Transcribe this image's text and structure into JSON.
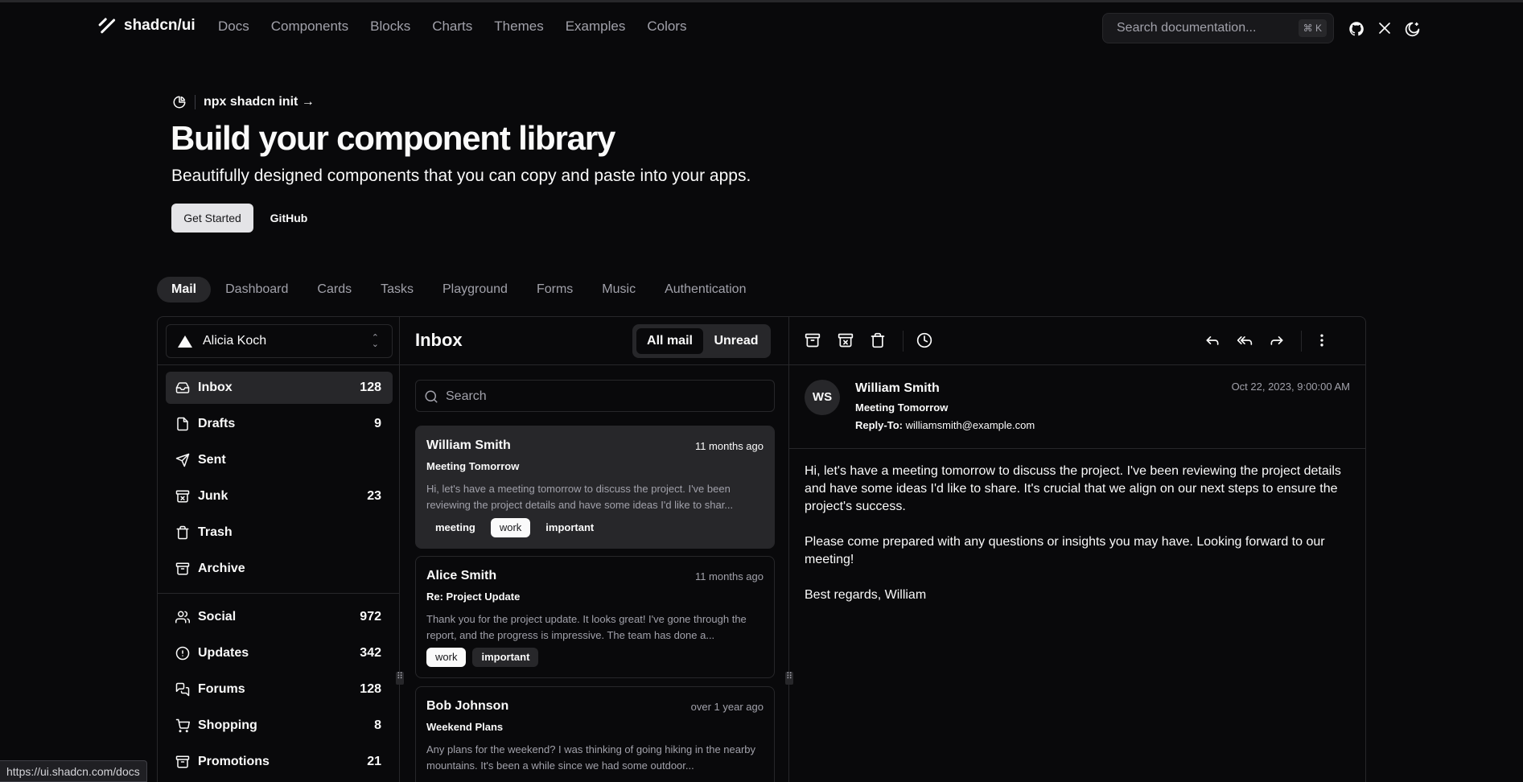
{
  "nav": {
    "logo": "shadcn/ui",
    "links": [
      "Docs",
      "Components",
      "Blocks",
      "Charts",
      "Themes",
      "Examples",
      "Colors"
    ],
    "search_placeholder": "Search documentation...",
    "search_kbd": "⌘ K",
    "icons": [
      "github-icon",
      "x-icon",
      "theme-toggle-icon"
    ]
  },
  "hero": {
    "announcement": "npx shadcn init →",
    "title": "Build your component library",
    "subtitle": "Beautifully designed components that you can copy and paste into your apps.",
    "primary_button": "Get Started",
    "secondary_button": "GitHub"
  },
  "example_tabs": {
    "items": [
      "Mail",
      "Dashboard",
      "Cards",
      "Tasks",
      "Playground",
      "Forms",
      "Music",
      "Authentication"
    ],
    "active": "Mail"
  },
  "mail": {
    "account": "Alicia Koch",
    "folders": [
      {
        "label": "Inbox",
        "count": "128",
        "icon": "inbox-icon",
        "active": true
      },
      {
        "label": "Drafts",
        "count": "9",
        "icon": "file-icon"
      },
      {
        "label": "Sent",
        "count": "",
        "icon": "send-icon"
      },
      {
        "label": "Junk",
        "count": "23",
        "icon": "archive-x-icon"
      },
      {
        "label": "Trash",
        "count": "",
        "icon": "trash-icon"
      },
      {
        "label": "Archive",
        "count": "",
        "icon": "archive-icon"
      }
    ],
    "categories": [
      {
        "label": "Social",
        "count": "972",
        "icon": "users-icon"
      },
      {
        "label": "Updates",
        "count": "342",
        "icon": "alert-circle-icon"
      },
      {
        "label": "Forums",
        "count": "128",
        "icon": "messages-icon"
      },
      {
        "label": "Shopping",
        "count": "8",
        "icon": "cart-icon"
      },
      {
        "label": "Promotions",
        "count": "21",
        "icon": "archive-icon"
      }
    ],
    "list": {
      "title": "Inbox",
      "toggle": [
        "All mail",
        "Unread"
      ],
      "toggle_active": "All mail",
      "search_placeholder": "Search",
      "messages": [
        {
          "from": "William Smith",
          "time": "11 months ago",
          "subject": "Meeting Tomorrow",
          "preview": "Hi, let's have a meeting tomorrow to discuss the project. I've been reviewing the project details and have some ideas I'd like to shar...",
          "tags": [
            "meeting",
            "work",
            "important"
          ],
          "selected": true
        },
        {
          "from": "Alice Smith",
          "time": "11 months ago",
          "subject": "Re: Project Update",
          "preview": "Thank you for the project update. It looks great! I've gone through the report, and the progress is impressive. The team has done a...",
          "tags": [
            "work",
            "important"
          ]
        },
        {
          "from": "Bob Johnson",
          "time": "over 1 year ago",
          "subject": "Weekend Plans",
          "preview": "Any plans for the weekend? I was thinking of going hiking in the nearby mountains. It's been a while since we had some outdoor...",
          "tags": []
        }
      ]
    },
    "detail": {
      "avatar_initials": "WS",
      "from": "William Smith",
      "subject": "Meeting Tomorrow",
      "reply_to_label": "Reply-To:",
      "reply_to": "williamsmith@example.com",
      "date": "Oct 22, 2023, 9:00:00 AM",
      "body": [
        "Hi, let's have a meeting tomorrow to discuss the project. I've been reviewing the project details and have some ideas I'd like to share. It's crucial that we align on our next steps to ensure the project's success.",
        "Please come prepared with any questions or insights you may have. Looking forward to our meeting!",
        "Best regards, William"
      ],
      "toolbar_icons": [
        "archive-icon",
        "archive-x-icon",
        "trash-icon",
        "clock-icon",
        "reply-icon",
        "reply-all-icon",
        "forward-icon",
        "more-vertical-icon"
      ]
    }
  },
  "status_bar": "https://ui.shadcn.com/docs"
}
